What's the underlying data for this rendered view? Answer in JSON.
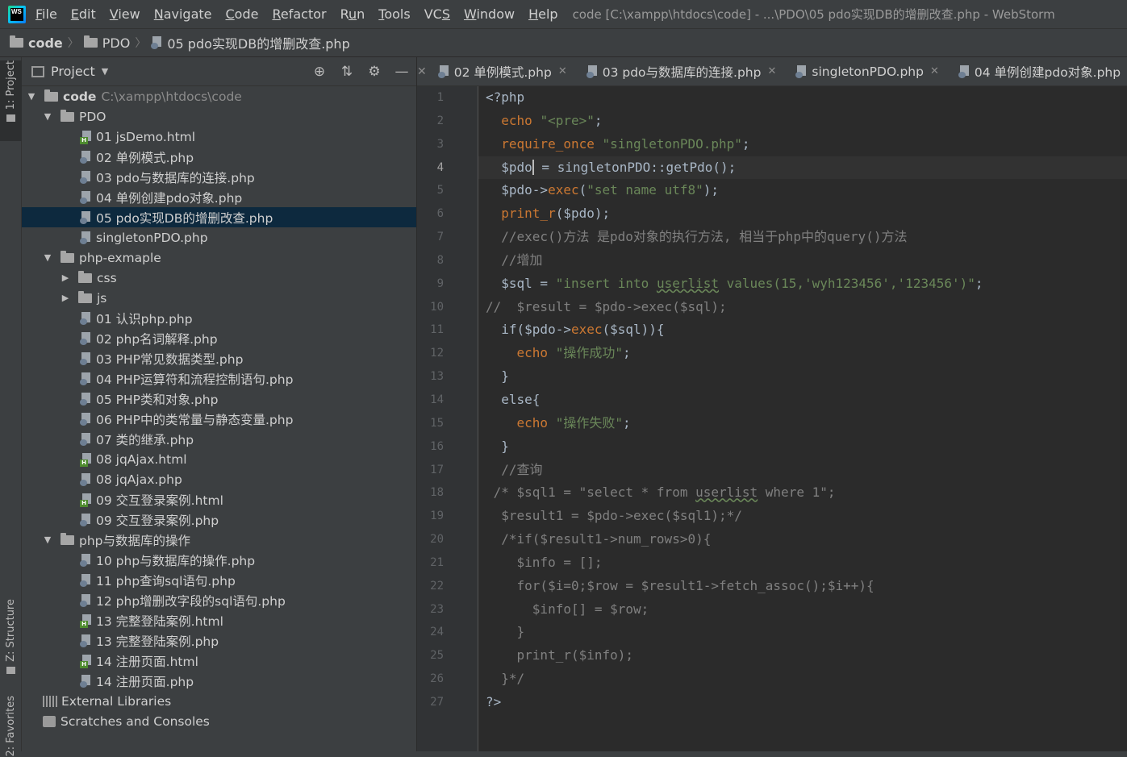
{
  "menubar": {
    "logo": "WS",
    "items": [
      {
        "label": "File"
      },
      {
        "label": "Edit"
      },
      {
        "label": "View"
      },
      {
        "label": "Navigate"
      },
      {
        "label": "Code"
      },
      {
        "label": "Refactor"
      },
      {
        "label": "Run"
      },
      {
        "label": "Tools"
      },
      {
        "label": "VCS"
      },
      {
        "label": "Window"
      },
      {
        "label": "Help"
      }
    ],
    "window_title": "code [C:\\xampp\\htdocs\\code] - ...\\PDO\\05 pdo实现DB的增删改查.php - WebStorm"
  },
  "breadcrumb": [
    "code",
    "PDO",
    "05 pdo实现DB的增删改查.php"
  ],
  "left_stripe": {
    "project": "1: Project",
    "structure": "Z: Structure",
    "favorites": "2: Favorites"
  },
  "project_panel": {
    "title": "Project",
    "root_label": "code",
    "root_path": "C:\\xampp\\htdocs\\code",
    "tree": [
      {
        "label": "PDO",
        "type": "folder",
        "depth": 1,
        "open": true
      },
      {
        "label": "01 jsDemo.html",
        "type": "html",
        "depth": 2
      },
      {
        "label": "02 单例模式.php",
        "type": "php",
        "depth": 2
      },
      {
        "label": "03 pdo与数据库的连接.php",
        "type": "php",
        "depth": 2
      },
      {
        "label": "04 单例创建pdo对象.php",
        "type": "php",
        "depth": 2
      },
      {
        "label": "05 pdo实现DB的增删改查.php",
        "type": "php",
        "depth": 2,
        "selected": true
      },
      {
        "label": "singletonPDO.php",
        "type": "php",
        "depth": 2
      },
      {
        "label": "php-exmaple",
        "type": "folder",
        "depth": 1,
        "open": true
      },
      {
        "label": "css",
        "type": "folder",
        "depth": 2,
        "open": false
      },
      {
        "label": "js",
        "type": "folder",
        "depth": 2,
        "open": false
      },
      {
        "label": "01 认识php.php",
        "type": "php",
        "depth": 2
      },
      {
        "label": "02 php名词解释.php",
        "type": "php",
        "depth": 2
      },
      {
        "label": "03 PHP常见数据类型.php",
        "type": "php",
        "depth": 2
      },
      {
        "label": " 04 PHP运算符和流程控制语句.php",
        "type": "php",
        "depth": 2
      },
      {
        "label": "05 PHP类和对象.php",
        "type": "php",
        "depth": 2
      },
      {
        "label": "06 PHP中的类常量与静态变量.php",
        "type": "php",
        "depth": 2
      },
      {
        "label": "07 类的继承.php",
        "type": "php",
        "depth": 2
      },
      {
        "label": "08 jqAjax.html",
        "type": "html",
        "depth": 2
      },
      {
        "label": "08 jqAjax.php",
        "type": "php",
        "depth": 2
      },
      {
        "label": "09 交互登录案例.html",
        "type": "html",
        "depth": 2
      },
      {
        "label": "09 交互登录案例.php",
        "type": "php",
        "depth": 2
      },
      {
        "label": "php与数据库的操作",
        "type": "folder",
        "depth": 1,
        "open": true
      },
      {
        "label": "10 php与数据库的操作.php",
        "type": "php",
        "depth": 2
      },
      {
        "label": "11 php查询sql语句.php",
        "type": "php",
        "depth": 2
      },
      {
        "label": "12 php增删改字段的sql语句.php",
        "type": "php",
        "depth": 2
      },
      {
        "label": "13 完整登陆案例.html",
        "type": "html",
        "depth": 2
      },
      {
        "label": "13 完整登陆案例.php",
        "type": "php",
        "depth": 2
      },
      {
        "label": "14 注册页面.html",
        "type": "html",
        "depth": 2
      },
      {
        "label": "14 注册页面.php",
        "type": "php",
        "depth": 2
      }
    ],
    "external_libraries": "External Libraries",
    "scratches": "Scratches and Consoles"
  },
  "editor": {
    "tabs": [
      {
        "label": "02 单例模式.php"
      },
      {
        "label": "03 pdo与数据库的连接.php"
      },
      {
        "label": "singletonPDO.php"
      },
      {
        "label": "04 单例创建pdo对象.php"
      }
    ],
    "current_line": 4,
    "lines": [
      [
        [
          "p",
          "<?php"
        ]
      ],
      [
        [
          "p",
          "  "
        ],
        [
          "k",
          "echo"
        ],
        [
          "p",
          " "
        ],
        [
          "s",
          "\"<pre>\""
        ],
        [
          "p",
          ";"
        ]
      ],
      [
        [
          "p",
          "  "
        ],
        [
          "k",
          "require_once"
        ],
        [
          "p",
          " "
        ],
        [
          "s",
          "\"singletonPDO.php\""
        ],
        [
          "p",
          ";"
        ]
      ],
      [
        [
          "p",
          "  $pdo"
        ],
        [
          "c",
          ""
        ],
        [
          "p",
          " = singletonPDO::getPdo();"
        ]
      ],
      [
        [
          "p",
          "  $pdo->"
        ],
        [
          "k",
          "exec"
        ],
        [
          "p",
          "("
        ],
        [
          "s",
          "\"set name utf8\""
        ],
        [
          "p",
          ");"
        ]
      ],
      [
        [
          "p",
          "  "
        ],
        [
          "k",
          "print_r"
        ],
        [
          "p",
          "($pdo);"
        ]
      ],
      [
        [
          "m",
          "  //exec()方法 是pdo对象的执行方法, 相当于php中的query()方法"
        ]
      ],
      [
        [
          "m",
          "  //增加"
        ]
      ],
      [
        [
          "p",
          "  $sql = "
        ],
        [
          "s",
          "\"insert into "
        ],
        [
          "u",
          "userlist"
        ],
        [
          "s",
          " values(15,'wyh123456','123456')\""
        ],
        [
          "p",
          ";"
        ]
      ],
      [
        [
          "m",
          "//  $result = $pdo->exec($sql);"
        ]
      ],
      [
        [
          "p",
          "  if($pdo->"
        ],
        [
          "k",
          "exec"
        ],
        [
          "p",
          "($sql)){"
        ]
      ],
      [
        [
          "p",
          "    "
        ],
        [
          "k",
          "echo"
        ],
        [
          "p",
          " "
        ],
        [
          "s",
          "\"操作成功\""
        ],
        [
          "p",
          ";"
        ]
      ],
      [
        [
          "p",
          "  }"
        ]
      ],
      [
        [
          "p",
          "  else{"
        ]
      ],
      [
        [
          "p",
          "    "
        ],
        [
          "k",
          "echo"
        ],
        [
          "p",
          " "
        ],
        [
          "s",
          "\"操作失败\""
        ],
        [
          "p",
          ";"
        ]
      ],
      [
        [
          "p",
          "  }"
        ]
      ],
      [
        [
          "m",
          "  //查询"
        ]
      ],
      [
        [
          "m",
          " /* $sql1 = \"select * from "
        ],
        [
          "mu",
          "userlist"
        ],
        [
          "m",
          " where 1\";"
        ]
      ],
      [
        [
          "m",
          "  $result1 = $pdo->exec($sql1);*/"
        ]
      ],
      [
        [
          "m",
          "  /*if($result1->num_rows>0){"
        ]
      ],
      [
        [
          "m",
          "    $info = [];"
        ]
      ],
      [
        [
          "m",
          "    for($i=0;$row = $result1->fetch_assoc();$i++){"
        ]
      ],
      [
        [
          "m",
          "      $info[] = $row;"
        ]
      ],
      [
        [
          "m",
          "    }"
        ]
      ],
      [
        [
          "m",
          "    print_r($info);"
        ]
      ],
      [
        [
          "m",
          "  }*/"
        ]
      ],
      [
        [
          "p",
          "?>"
        ]
      ]
    ]
  }
}
